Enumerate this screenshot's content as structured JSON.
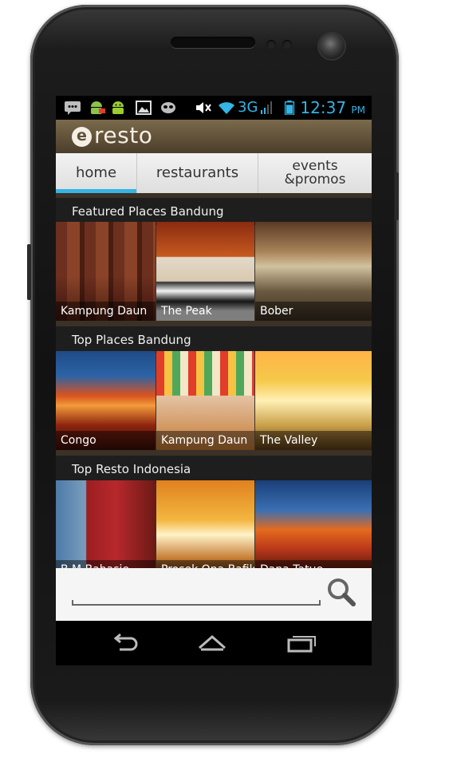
{
  "status_bar": {
    "network": "3G",
    "time": "12:37",
    "ampm": "PM",
    "icons": [
      "message-icon",
      "android-debug-icon",
      "android-icon",
      "image-icon",
      "alien-icon",
      "mute-icon",
      "wifi-icon",
      "signal-icon",
      "battery-icon"
    ]
  },
  "app": {
    "logo_letter": "e",
    "name": "resto"
  },
  "tabs": [
    {
      "label": "home",
      "active": true
    },
    {
      "label": "restaurants",
      "active": false
    },
    {
      "label_line1": "events",
      "label_line2": "&promos",
      "active": false
    }
  ],
  "sections": [
    {
      "title": "Featured Places Bandung",
      "items": [
        {
          "name": "Kampung Daun"
        },
        {
          "name": "The Peak"
        },
        {
          "name": "Bober"
        }
      ]
    },
    {
      "title": "Top Places Bandung",
      "items": [
        {
          "name": "Congo"
        },
        {
          "name": "Kampung Daun"
        },
        {
          "name": "The Valley"
        }
      ]
    },
    {
      "title": "Top Resto Indonesia",
      "items": [
        {
          "name": "B.M Bahasie"
        },
        {
          "name": "Prosek Ona Bafik"
        },
        {
          "name": "Dana Tatue"
        }
      ]
    }
  ],
  "search": {
    "value": "",
    "placeholder": ""
  },
  "colors": {
    "accent": "#33b5e5",
    "appbar": "#5e4f37"
  }
}
